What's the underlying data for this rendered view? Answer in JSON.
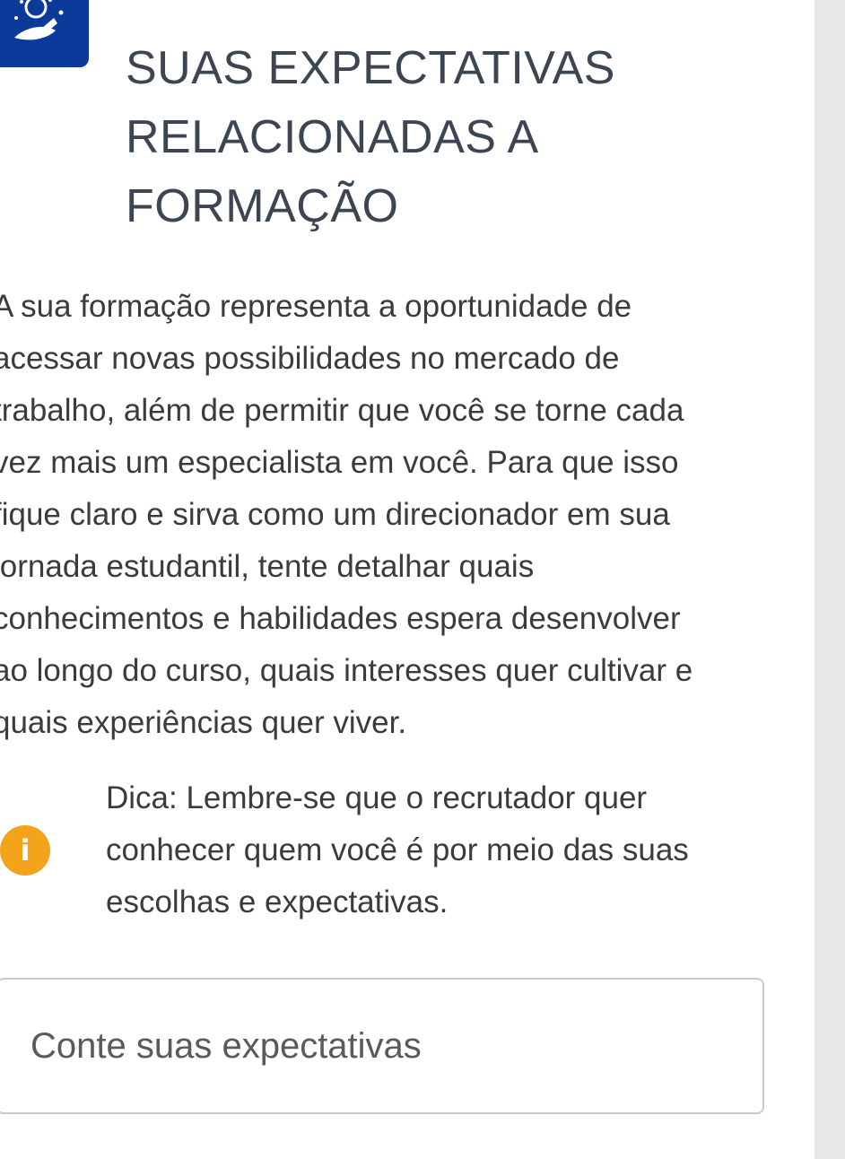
{
  "colors": {
    "badge_bg": "#0b3a9b",
    "title_text": "#3c4653",
    "body_text": "#3b3b3b",
    "tip_icon_bg": "#f3a31a",
    "input_border": "#c9c9c9"
  },
  "header": {
    "icon": "astronaut-thinking-icon",
    "title_lines": [
      "SUAS EXPECTATIVAS",
      "RELACIONADAS A",
      "FORMAÇÃO"
    ]
  },
  "intro": {
    "lines": [
      "A sua formação representa a oportunidade de",
      "acessar novas possibilidades no mercado de",
      "trabalho, além de permitir que você se torne cada",
      "vez mais um especialista em você. Para que isso",
      "fique claro e sirva como um direcionador em sua",
      "jornada estudantil, tente detalhar quais",
      "conhecimentos e habilidades espera desenvolver",
      "ao longo do curso, quais interesses quer cultivar e",
      "quais experiências quer viver."
    ]
  },
  "tip": {
    "icon": "info-icon",
    "icon_glyph": "i",
    "lines": [
      "Dica: Lembre-se que o recrutador quer",
      "conhecer quem você é por meio das suas",
      "escolhas e expectativas."
    ]
  },
  "answer": {
    "placeholder": "Conte suas expectativas",
    "value": ""
  }
}
